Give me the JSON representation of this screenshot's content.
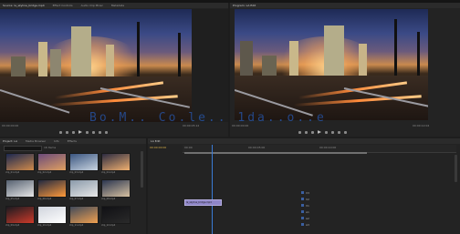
{
  "source_monitor": {
    "tab_label": "Source: la_skyline_bridge.mp4",
    "tabs": [
      "Effect Controls",
      "Audio Clip Mixer",
      "Metadata"
    ],
    "timecode_left": "00:00:00:00",
    "timecode_right": "00:00:05:12"
  },
  "program_monitor": {
    "tab_label": "Program: LA Edit",
    "timecode_left": "00:00:00:00",
    "timecode_right": "00:00:12:04"
  },
  "project_panel": {
    "tabs": [
      "Project: LA",
      "Media Browser",
      "Info",
      "Effects"
    ],
    "item_count": "16 Items",
    "thumbnails": [
      {
        "label": "clip_01.mp4",
        "colors": [
          "#1b2850",
          "#d08a4a"
        ]
      },
      {
        "label": "clip_02.mp4",
        "colors": [
          "#6a4a7a",
          "#e0a060"
        ]
      },
      {
        "label": "clip_03.mp4",
        "colors": [
          "#3a5580",
          "#c9d4e0"
        ]
      },
      {
        "label": "clip_04.mp4",
        "colors": [
          "#2b2b40",
          "#f0b070"
        ]
      },
      {
        "label": "clip_05.mp4",
        "colors": [
          "#556070",
          "#e6e6e6"
        ]
      },
      {
        "label": "clip_06.mp4",
        "colors": [
          "#202840",
          "#ff9a3a"
        ]
      },
      {
        "label": "clip_07.mp4",
        "colors": [
          "#8a9aaa",
          "#e8e8e8"
        ]
      },
      {
        "label": "clip_08.mp4",
        "colors": [
          "#2a3550",
          "#d6c0a0"
        ]
      },
      {
        "label": "clip_09.mp4",
        "colors": [
          "#1a1a20",
          "#cc3a2a"
        ]
      },
      {
        "label": "clip_10.mp4",
        "colors": [
          "#d0d4dc",
          "#ffffff"
        ]
      },
      {
        "label": "clip_11.mp4",
        "colors": [
          "#404a5a",
          "#f0a050"
        ]
      },
      {
        "label": "clip_12.mp4",
        "colors": [
          "#101014",
          "#2a2a2a"
        ]
      }
    ]
  },
  "timeline": {
    "tab_label": "LA Edit",
    "timecode": "00:00:00:00",
    "ruler_marks": [
      "00:00",
      "00:00:05:00",
      "00:00:10:00"
    ],
    "tracks": [
      "V3",
      "V2",
      "V1",
      "A1",
      "A2",
      "A3"
    ],
    "clip_label": "la_skyline_bridge.mp4"
  },
  "watermark": "Bo.M.. Co.le.. 1da..o..e",
  "colors": {
    "accent": "#3a7bd5",
    "clip": "#8f86c8",
    "playhead": "#3a7bd5"
  }
}
